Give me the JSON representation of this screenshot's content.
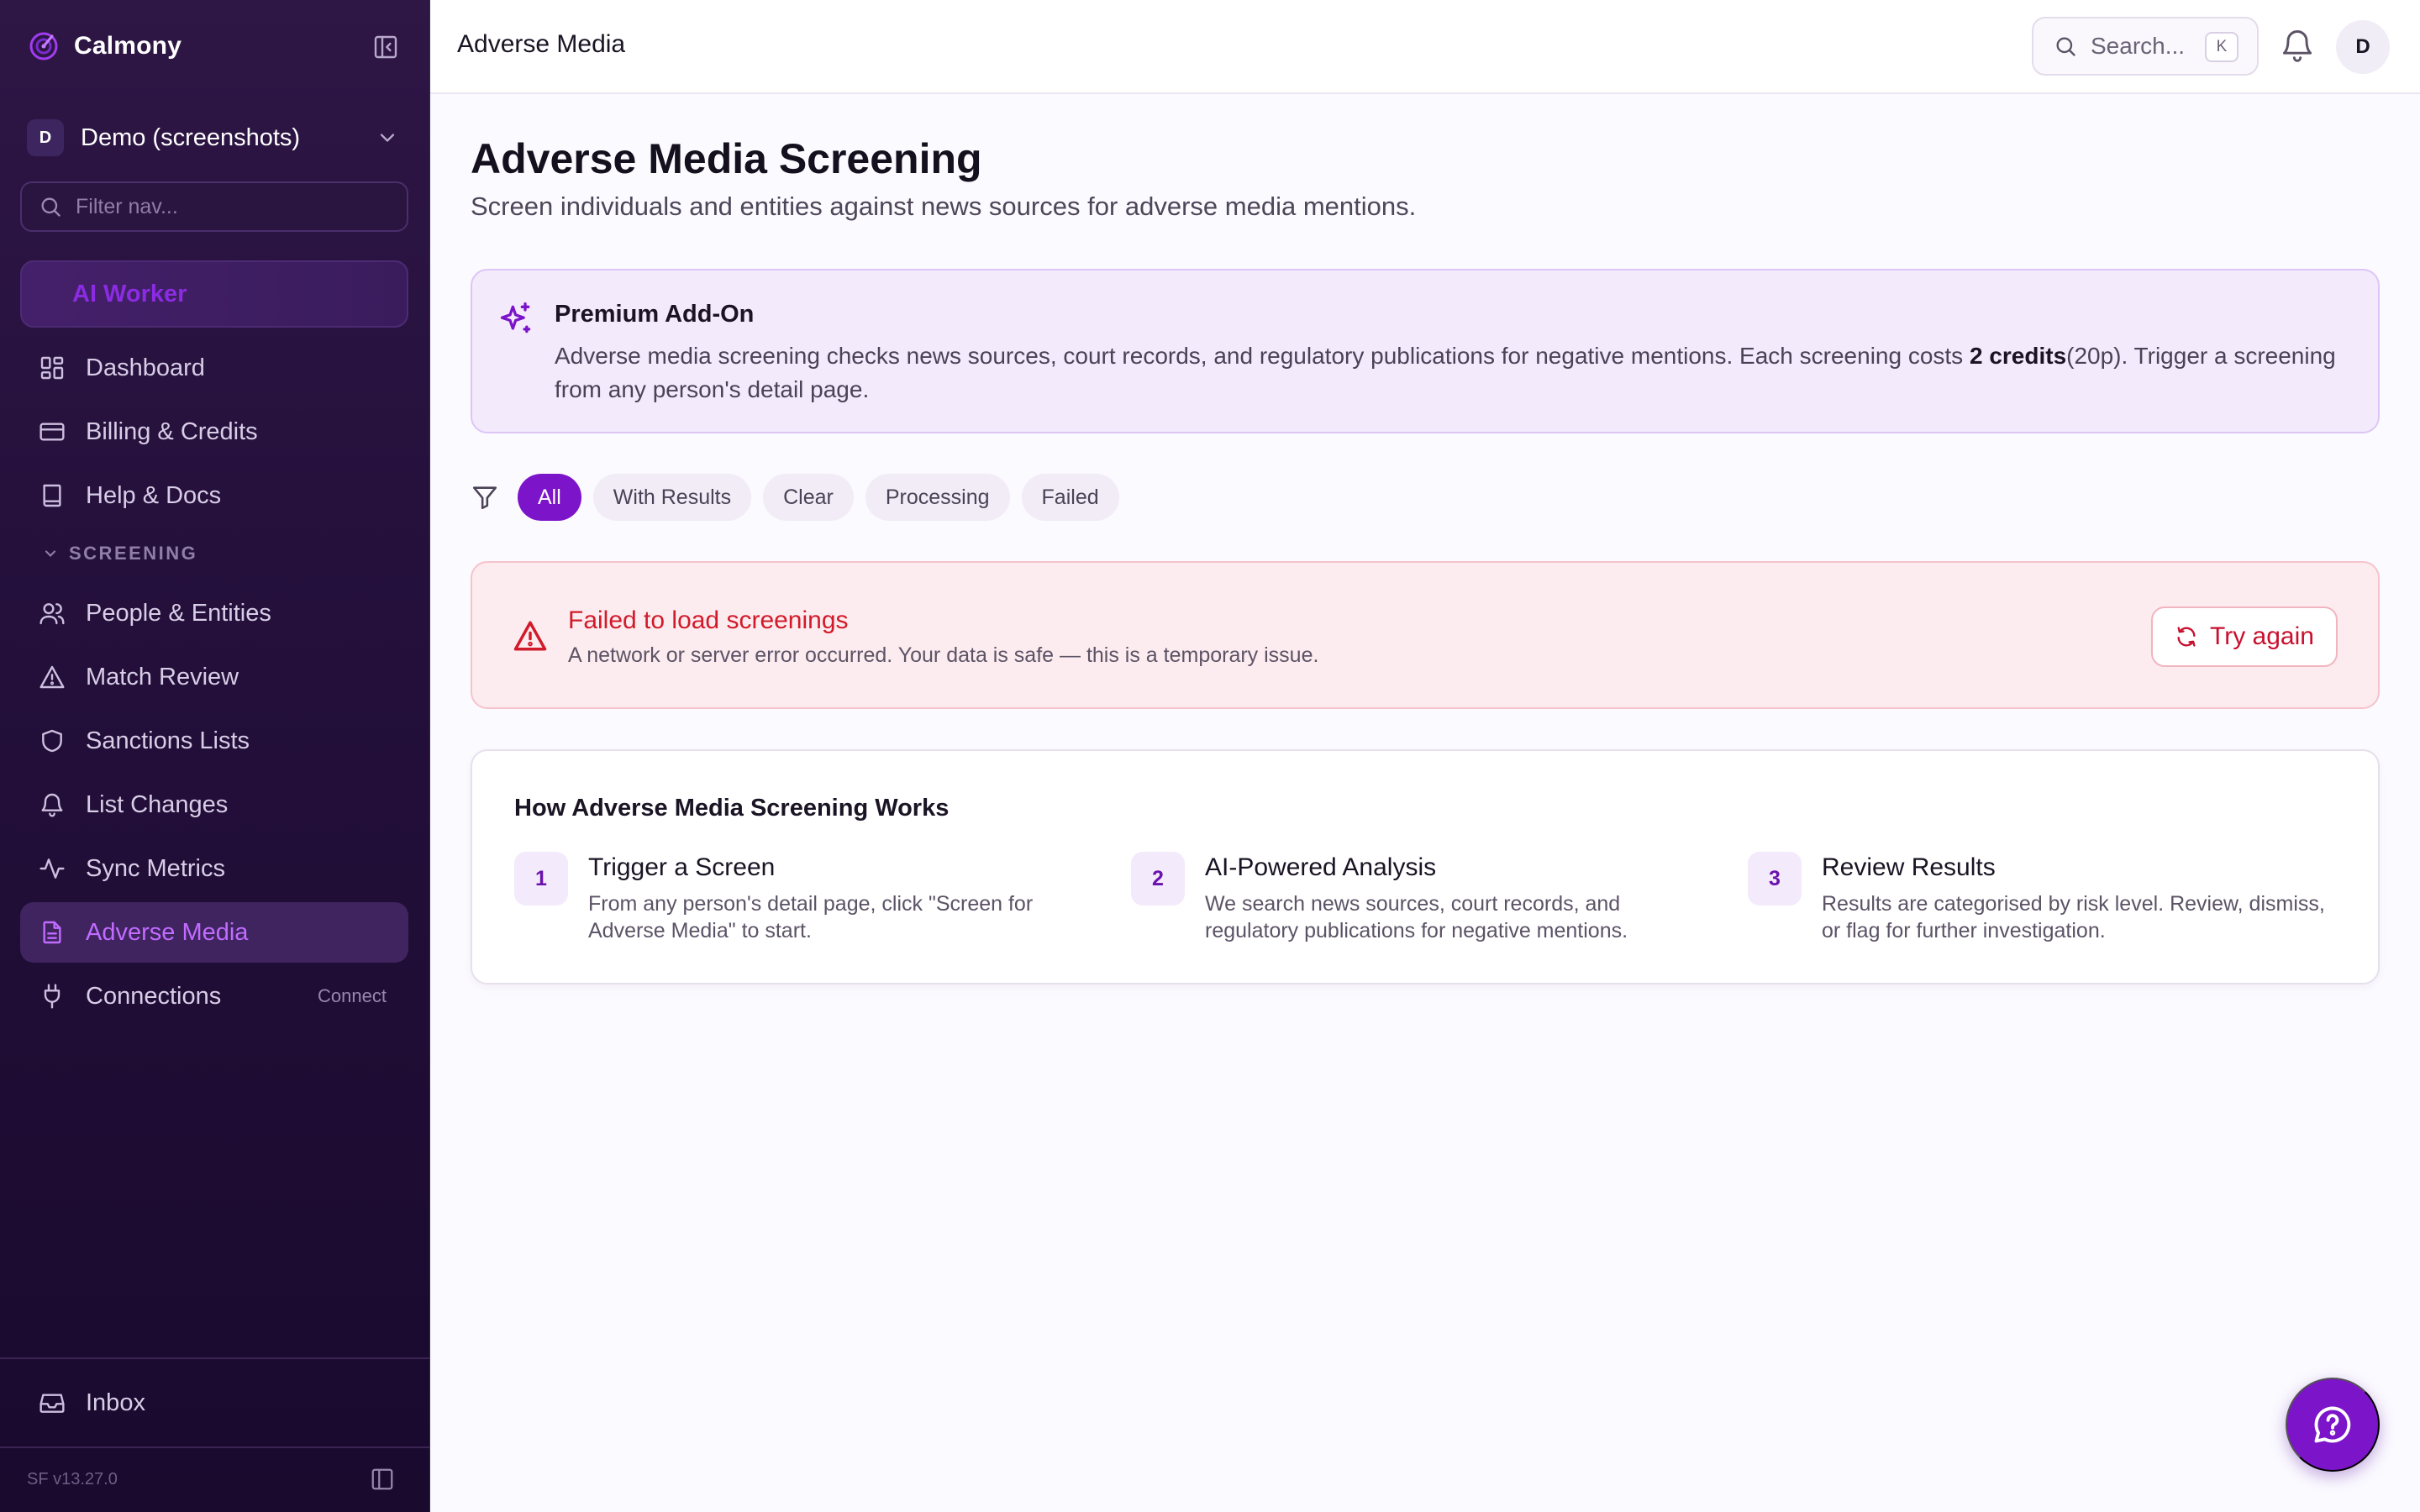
{
  "colors": {
    "sidebar_bg": "#2a1340",
    "accent": "#7c14c9",
    "active_nav_text": "#c16bff",
    "error_text": "#d11a2a",
    "addon_bg": "#f3eafc"
  },
  "sidebar": {
    "brand": "Calmony",
    "brand_icon": "calmony-logo-icon",
    "org": {
      "initial": "D",
      "name": "Demo (screenshots)"
    },
    "filter_placeholder": "Filter nav...",
    "ai_worker": "AI Worker",
    "items_top": [
      {
        "label": "Dashboard",
        "icon": "dashboard-grid-icon"
      },
      {
        "label": "Billing & Credits",
        "icon": "credit-card-icon"
      },
      {
        "label": "Help & Docs",
        "icon": "book-icon"
      }
    ],
    "section": "SCREENING",
    "items_screening": [
      {
        "label": "People & Entities",
        "icon": "users-icon"
      },
      {
        "label": "Match Review",
        "icon": "alert-triangle-icon"
      },
      {
        "label": "Sanctions Lists",
        "icon": "shield-icon"
      },
      {
        "label": "List Changes",
        "icon": "bell-icon"
      },
      {
        "label": "Sync Metrics",
        "icon": "activity-icon"
      },
      {
        "label": "Adverse Media",
        "icon": "file-text-icon",
        "active": true
      },
      {
        "label": "Connections",
        "icon": "plug-icon",
        "suffix": "Connect"
      }
    ],
    "inbox": "Inbox",
    "version": "SF v13.27.0"
  },
  "topbar": {
    "title": "Adverse Media",
    "search_placeholder": "Search...",
    "search_kbd": "K",
    "avatar_initial": "D"
  },
  "main": {
    "title": "Adverse Media Screening",
    "subtitle": "Screen individuals and entities against news sources for adverse media mentions.",
    "addon": {
      "title": "Premium Add-On",
      "body_before": "Adverse media screening checks news sources, court records, and regulatory publications for negative mentions. Each screening costs ",
      "credits": "2 credits",
      "body_after": "(20p). Trigger a screening from any person's detail page."
    },
    "filters": [
      "All",
      "With Results",
      "Clear",
      "Processing",
      "Failed"
    ],
    "active_filter": "All",
    "error": {
      "title": "Failed to load screenings",
      "message": "A network or server error occurred. Your data is safe — this is a temporary issue.",
      "retry": "Try again"
    },
    "how": {
      "title": "How Adverse Media Screening Works",
      "steps": [
        {
          "num": "1",
          "title": "Trigger a Screen",
          "desc": "From any person's detail page, click \"Screen for Adverse Media\" to start."
        },
        {
          "num": "2",
          "title": "AI-Powered Analysis",
          "desc": "We search news sources, court records, and regulatory publications for negative mentions."
        },
        {
          "num": "3",
          "title": "Review Results",
          "desc": "Results are categorised by risk level. Review, dismiss, or flag for further investigation."
        }
      ]
    }
  }
}
